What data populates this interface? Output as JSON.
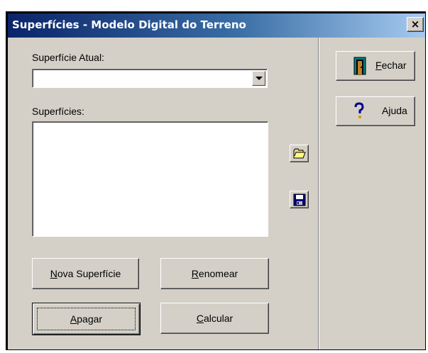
{
  "window": {
    "title": "Superfícies - Modelo Digital do Terreno",
    "close_glyph": "×"
  },
  "current_surface": {
    "label": "Superfície Atual:",
    "value": ""
  },
  "surfaces": {
    "label": "Superfícies:",
    "items": []
  },
  "tools": {
    "open_icon": "folder-open-icon",
    "save_icon": "floppy-disk-icon"
  },
  "buttons": {
    "new_surface": {
      "accel": "N",
      "rest": "ova Superfície"
    },
    "rename": {
      "accel": "R",
      "rest": "enomear"
    },
    "delete": {
      "accel": "A",
      "rest": "pagar"
    },
    "calculate": {
      "accel": "C",
      "rest": "alcular"
    }
  },
  "side": {
    "close": {
      "accel": "F",
      "rest": "echar",
      "icon": "door-exit-icon"
    },
    "help": {
      "label": "Ajuda",
      "icon": "question-mark-icon"
    }
  },
  "colors": {
    "titlebar_start": "#0a246a",
    "titlebar_end": "#a6caf0",
    "face": "#d4d0c8"
  }
}
